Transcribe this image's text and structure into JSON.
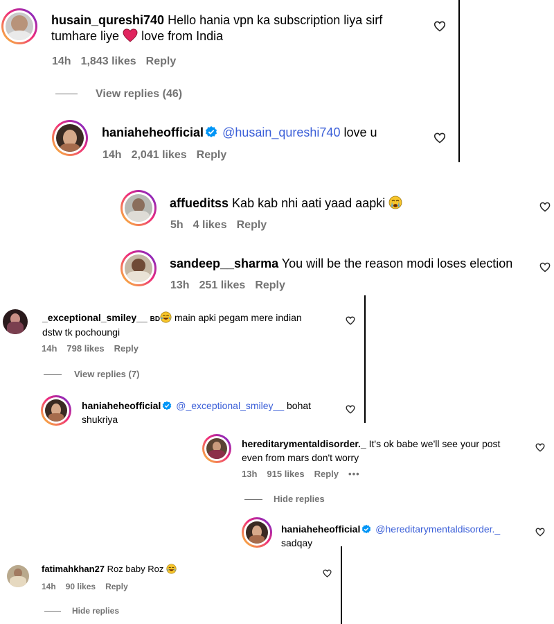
{
  "comments": [
    {
      "username": "husain_qureshi740",
      "text_before": "Hello hania vpn ka subscription liya sirf",
      "text_line2_before": "tumhare liye",
      "text_line2_after": "love from India",
      "time": "14h",
      "likes": "1,843 likes",
      "reply": "Reply",
      "view_replies": "View replies (46)"
    },
    {
      "username": "haniaheheofficial",
      "mention": "@husain_qureshi740",
      "text": "love u",
      "time": "14h",
      "likes": "2,041 likes",
      "reply": "Reply"
    },
    {
      "username": "affueditss",
      "text": "Kab kab nhi aati yaad aapki",
      "time": "5h",
      "likes": "4 likes",
      "reply": "Reply"
    },
    {
      "username": "sandeep__sharma",
      "text": "You will be the reason modi loses election",
      "time": "13h",
      "likes": "251 likes",
      "reply": "Reply"
    },
    {
      "username": "_exceptional_smiley__",
      "badge": "BD",
      "text_line1": "main apki pegam mere indian",
      "text_line2": "dstw tk pochoungi",
      "time": "14h",
      "likes": "798 likes",
      "reply": "Reply",
      "view_replies": "View replies (7)"
    },
    {
      "username": "haniaheheofficial",
      "mention": "@_exceptional_smiley__",
      "text_line1": "bohat",
      "text_line2": "shukriya"
    },
    {
      "username": "hereditarymentaldisorder._",
      "text_line1": "It's ok babe we'll see your post",
      "text_line2": "even from mars don't worry",
      "time": "13h",
      "likes": "915 likes",
      "reply": "Reply",
      "more": "•••",
      "hide_replies": "Hide replies"
    },
    {
      "username": "haniaheheofficial",
      "mention": "@hereditarymentaldisorder._",
      "text_line2": "sadqay"
    },
    {
      "username": "fatimahkhan27",
      "text": "Roz baby Roz",
      "time": "14h",
      "likes": "90 likes",
      "reply": "Reply",
      "hide_replies": "Hide replies"
    }
  ],
  "colors": {
    "mention": "#3b5fd8",
    "meta": "#737373",
    "heart_red": "#e0245e",
    "verified": "#0095f6"
  },
  "icons": {
    "like": "heart-outline-icon",
    "verified": "verified-badge-icon"
  }
}
